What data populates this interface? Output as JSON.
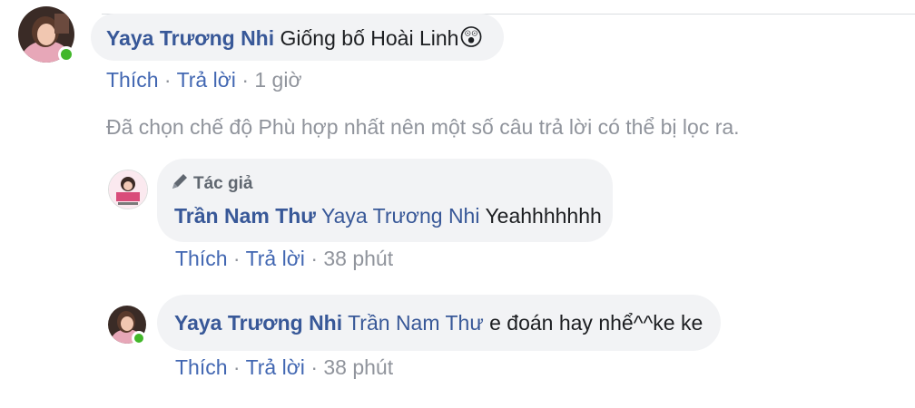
{
  "comments": [
    {
      "author": "Yaya Trương Nhi",
      "text": "Giống bố Hoài Linh",
      "emoji": "😲",
      "like_label": "Thích",
      "reply_label": "Trả lời",
      "dot": "·",
      "time": "1 giờ",
      "avatar_icon": "profile-photo"
    }
  ],
  "filter_note": "Đã chọn chế độ Phù hợp nhất nên một số câu trả lời có thể bị lọc ra.",
  "replies": [
    {
      "badge_label": "Tác giả",
      "badge_icon": "pencil-icon",
      "author": "Trần Nam Thư",
      "mention": "Yaya Trương Nhi",
      "text": "Yeahhhhhhh",
      "like_label": "Thích",
      "reply_label": "Trả lời",
      "dot": "·",
      "time": "38 phút"
    },
    {
      "author": "Yaya Trương Nhi",
      "mention": "Trần Nam Thư",
      "text": "e đoán hay nhể^^ke ke",
      "like_label": "Thích",
      "reply_label": "Trả lời",
      "dot": "·",
      "time": "38 phút"
    }
  ],
  "colors": {
    "author_link": "#385898",
    "action_link": "#4267b2",
    "meta_gray": "#90949c",
    "bubble_bg": "#f2f3f5",
    "online_green": "#42b72a"
  }
}
